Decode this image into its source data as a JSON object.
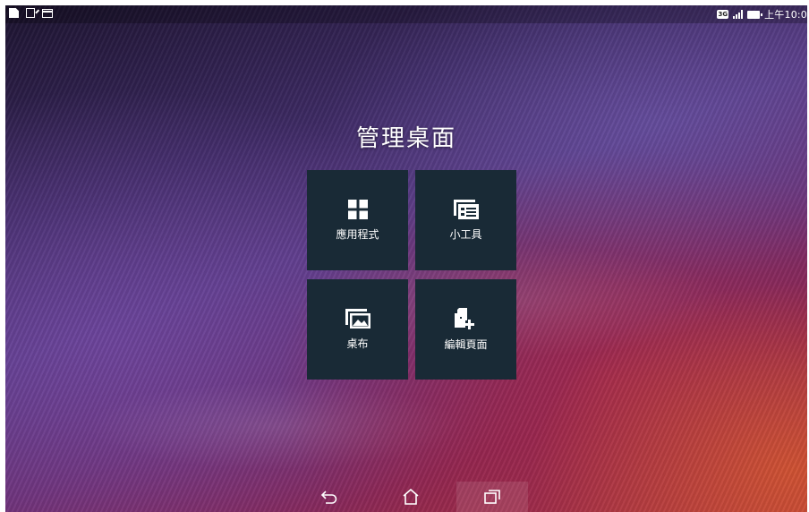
{
  "status_bar": {
    "left_icons": [
      "document-icon",
      "edit-icon",
      "window-icon"
    ],
    "network": "3G",
    "time": "上午10:0"
  },
  "page": {
    "title": "管理桌面"
  },
  "tiles": [
    {
      "label": "應用程式",
      "icon": "apps-grid-icon"
    },
    {
      "label": "小工具",
      "icon": "widgets-icon"
    },
    {
      "label": "桌布",
      "icon": "wallpaper-icon"
    },
    {
      "label": "編輯頁面",
      "icon": "edit-page-icon"
    }
  ],
  "navigation": {
    "buttons": [
      "back-icon",
      "home-icon",
      "recent-apps-icon"
    ]
  },
  "colors": {
    "tile_background": "#192a36",
    "text": "#ffffff"
  }
}
